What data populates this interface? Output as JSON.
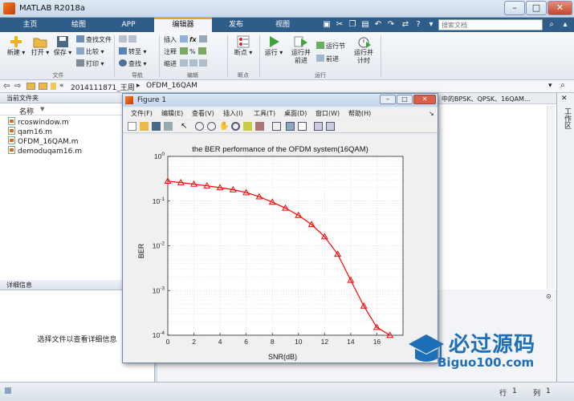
{
  "window": {
    "title": "MATLAB R2018a",
    "controls": {
      "minimize": "–",
      "maximize": "□",
      "close": "✕"
    }
  },
  "tabs": [
    {
      "label": "主页"
    },
    {
      "label": "绘图"
    },
    {
      "label": "APP"
    },
    {
      "label": "编辑器",
      "active": true
    },
    {
      "label": "发布"
    },
    {
      "label": "视图"
    }
  ],
  "search": {
    "placeholder": "搜索文档"
  },
  "ribbon": {
    "file": {
      "label": "文件",
      "new": "新建",
      "open": "打开",
      "save": "保存",
      "find_files": "查找文件",
      "compare": "比较",
      "print": "打印"
    },
    "navigate": {
      "label": "导航",
      "goto": "转至",
      "find": "查找"
    },
    "edit": {
      "label": "编辑",
      "insert": "插入",
      "comment": "注释",
      "indent": "缩进",
      "fx": "fx"
    },
    "breakpoints": {
      "label": "断点",
      "breakpoints": "断点"
    },
    "run": {
      "label": "运行",
      "run": "运行",
      "run_advance_1": "运行并",
      "run_advance_2": "前进",
      "run_section": "运行节",
      "advance": "前进",
      "run_time_1": "运行并",
      "run_time_2": "计时"
    }
  },
  "path": {
    "prefix": "«",
    "parts": [
      "2014111871_王周",
      "OFDM_16QAM"
    ]
  },
  "current_folder": {
    "title": "当前文件夹",
    "column_name": "名称",
    "files": [
      "rcoswindow.m",
      "qam16.m",
      "OFDM_16QAM.m",
      "demoduqam16.m"
    ]
  },
  "details": {
    "title": "详细信息",
    "empty_text": "选择文件以查看详细信息"
  },
  "editor": {
    "tab_text": "中的BPSK、QPSK、16QAM..."
  },
  "right_panel": {
    "label": "工作区"
  },
  "status": {
    "line_label": "行",
    "line_value": "1",
    "col_label": "列",
    "col_value": "1"
  },
  "figure": {
    "title": "Figure 1",
    "menus": [
      "文件(F)",
      "编辑(E)",
      "查看(V)",
      "插入(I)",
      "工具(T)",
      "桌面(D)",
      "窗口(W)",
      "帮助(H)"
    ],
    "dock_arrow": "↘"
  },
  "watermark": {
    "text": "必过源码",
    "url": "Biguo100.com"
  },
  "colors": {
    "line": "#ff0000",
    "ribbon_tab_bg": "#2f5d8a",
    "accent": "#f0a030"
  },
  "chart_data": {
    "type": "line",
    "title": "the BER  performance of the OFDM system(16QAM)",
    "xlabel": "SNR(dB)",
    "ylabel": "BER",
    "xlim": [
      0,
      18
    ],
    "ylim": [
      0.0001,
      1
    ],
    "yscale": "log",
    "grid": true,
    "x_ticks": [
      0,
      2,
      4,
      6,
      8,
      10,
      12,
      14,
      16
    ],
    "y_ticks": [
      {
        "value": 1,
        "exp": "0"
      },
      {
        "value": 0.1,
        "exp": "-1"
      },
      {
        "value": 0.01,
        "exp": "-2"
      },
      {
        "value": 0.001,
        "exp": "-3"
      },
      {
        "value": 0.0001,
        "exp": "-4"
      }
    ],
    "tick_base": "10",
    "series": [
      {
        "marker": "triangle",
        "color": "#ff0000",
        "x": [
          0,
          1,
          2,
          3,
          4,
          5,
          6,
          7,
          8,
          9,
          10,
          11,
          12,
          13,
          14,
          15,
          16,
          17
        ],
        "y": [
          0.28,
          0.26,
          0.24,
          0.22,
          0.2,
          0.18,
          0.155,
          0.125,
          0.095,
          0.07,
          0.048,
          0.03,
          0.016,
          0.0065,
          0.0017,
          0.00045,
          0.00015,
          0.0001
        ]
      }
    ]
  }
}
